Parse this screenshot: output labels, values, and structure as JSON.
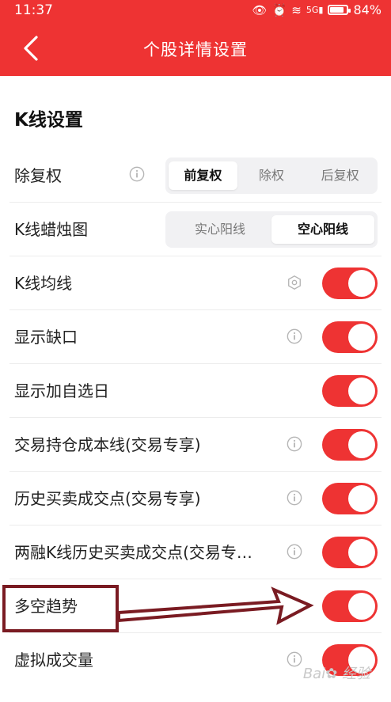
{
  "status_bar": {
    "time": "11:37",
    "battery_percent": "84%",
    "battery_level": 0.84,
    "network": "5G"
  },
  "header": {
    "title": "个股详情设置",
    "back_icon": "chevron-left-icon",
    "color": "#ee3333"
  },
  "section": {
    "title": "K线设置"
  },
  "rows": {
    "adjust": {
      "label": "除复权",
      "options": [
        "前复权",
        "除权",
        "后复权"
      ],
      "selected": "前复权"
    },
    "candle": {
      "label": "K线蜡烛图",
      "options": [
        "实心阳线",
        "空心阳线"
      ],
      "selected": "空心阳线"
    },
    "ma": {
      "label": "K线均线",
      "icon": "hexagon-settings-icon",
      "on": true
    },
    "gap": {
      "label": "显示缺口",
      "icon": "info-icon",
      "on": true
    },
    "watch_day": {
      "label": "显示加自选日",
      "on": true
    },
    "cost_line": {
      "label": "交易持仓成本线(交易专享)",
      "icon": "info-icon",
      "on": true
    },
    "trade_points": {
      "label": "历史买卖成交点(交易专享)",
      "icon": "info-icon",
      "on": true
    },
    "margin_points": {
      "label": "两融K线历史买卖成交点(交易专…",
      "icon": "info-icon",
      "on": true
    },
    "trend": {
      "label": "多空趋势",
      "on": true
    },
    "virtual_vol": {
      "label": "虚拟成交量",
      "icon": "info-icon",
      "on": true
    }
  },
  "annotation_color": "#7a1b22",
  "accent_color": "#ee3333"
}
